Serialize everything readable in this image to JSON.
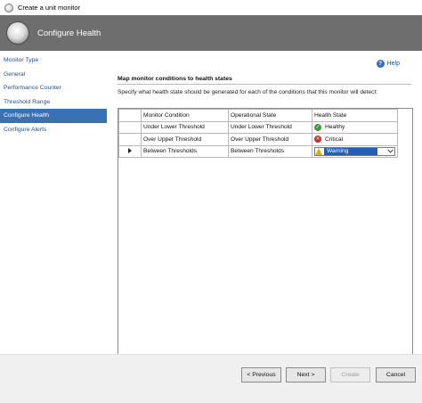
{
  "window": {
    "title": "Create a unit monitor"
  },
  "header": {
    "title": "Configure Health"
  },
  "nav": {
    "items": [
      {
        "label": "Monitor Type",
        "active": false
      },
      {
        "label": "General",
        "active": false
      },
      {
        "label": "Performance Counter",
        "active": false
      },
      {
        "label": "Threshold Range",
        "active": false
      },
      {
        "label": "Configure Health",
        "active": true
      },
      {
        "label": "Configure Alerts",
        "active": false
      }
    ]
  },
  "help": {
    "label": "Help"
  },
  "section": {
    "title": "Map monitor conditions to health states",
    "instructions": "Specify what health state should be generated for each of the conditions that this monitor will detect:"
  },
  "grid": {
    "headers": {
      "condition": "Monitor Condition",
      "operational": "Operational State",
      "health": "Health State"
    },
    "rows": [
      {
        "condition": "Under Lower Threshold",
        "operational": "Under Lower Threshold",
        "health": "Healthy",
        "health_icon": "check-circle-icon"
      },
      {
        "condition": "Over Upper Threshold",
        "operational": "Over Upper Threshold",
        "health": "Critical",
        "health_icon": "error-circle-icon"
      },
      {
        "condition": "Between Thresholds",
        "operational": "Between Thresholds",
        "health": "Warning",
        "health_icon": "warning-triangle-icon",
        "selected": true
      }
    ]
  },
  "buttons": {
    "previous": "< Previous",
    "next": "Next >",
    "create": "Create",
    "cancel": "Cancel"
  },
  "colors": {
    "header_bg": "#6e6e6e",
    "nav_active": "#3672b4",
    "link": "#1e4f8f",
    "healthy": "#3c9a3a",
    "critical": "#cc2b2b",
    "warning": "#e0b000"
  }
}
